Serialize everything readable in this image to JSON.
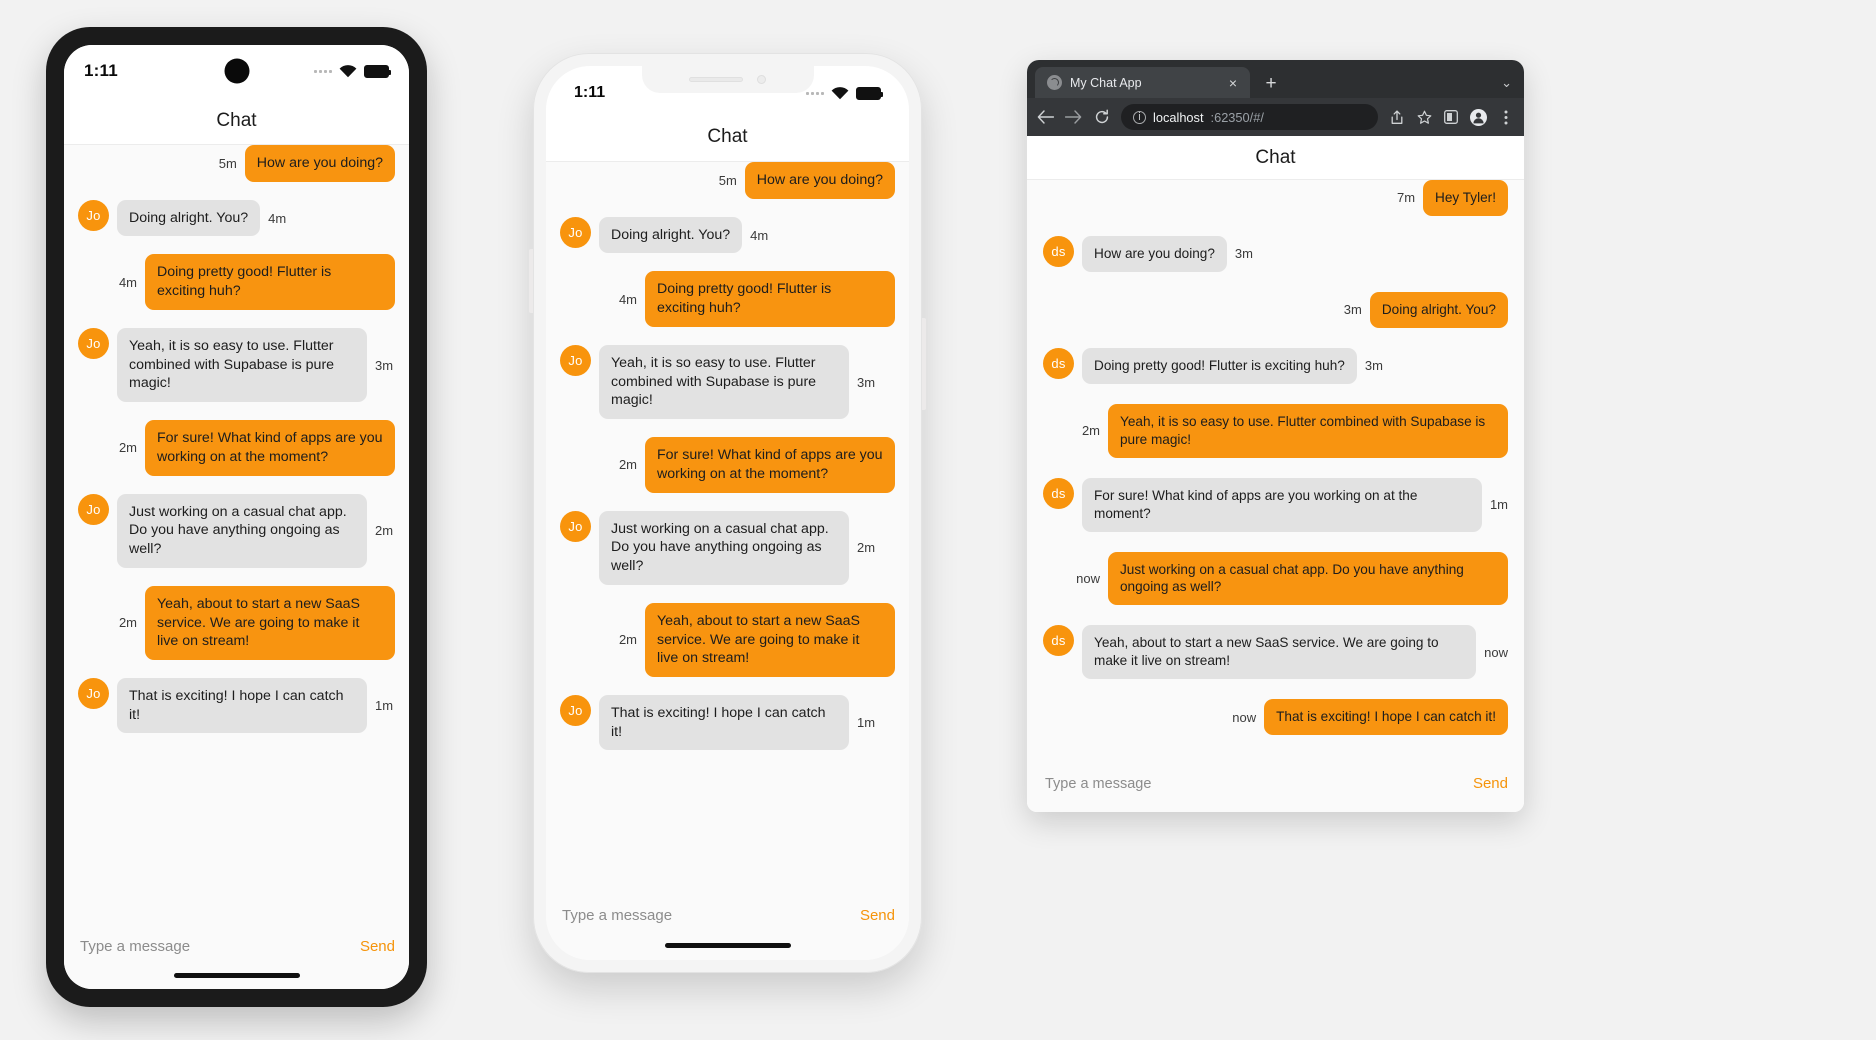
{
  "devices": {
    "android": {
      "statusbar": {
        "time": "1:11",
        "signal_icon": "signal-dots-icon",
        "wifi_icon": "wifi-icon",
        "battery_icon": "battery-icon"
      },
      "appbar": {
        "title": "Chat"
      },
      "compose": {
        "placeholder": "Type a message",
        "value": "",
        "send_label": "Send"
      },
      "messages": [
        {
          "side": "mine",
          "text": "How are you doing?",
          "time": "5m",
          "avatar": ""
        },
        {
          "side": "other",
          "text": "Doing alright. You?",
          "time": "4m",
          "avatar": "Jo"
        },
        {
          "side": "mine",
          "text": "Doing pretty good! Flutter is exciting huh?",
          "time": "4m",
          "avatar": ""
        },
        {
          "side": "other",
          "text": "Yeah, it is so easy to use. Flutter combined with Supabase is pure magic!",
          "time": "3m",
          "avatar": "Jo"
        },
        {
          "side": "mine",
          "text": "For sure! What kind of apps are you working on at the moment?",
          "time": "2m",
          "avatar": ""
        },
        {
          "side": "other",
          "text": "Just working on a casual chat app. Do you have anything ongoing as well?",
          "time": "2m",
          "avatar": "Jo"
        },
        {
          "side": "mine",
          "text": "Yeah, about to start a new SaaS service. We are going to make it live on stream!",
          "time": "2m",
          "avatar": ""
        },
        {
          "side": "other",
          "text": "That is exciting! I hope I can catch it!",
          "time": "1m",
          "avatar": "Jo"
        }
      ]
    },
    "iphone": {
      "statusbar": {
        "time": "1:11",
        "signal_icon": "signal-dots-icon",
        "wifi_icon": "wifi-icon",
        "battery_icon": "battery-icon"
      },
      "appbar": {
        "title": "Chat"
      },
      "compose": {
        "placeholder": "Type a message",
        "value": "",
        "send_label": "Send"
      },
      "messages": [
        {
          "side": "mine",
          "text": "How are you doing?",
          "time": "5m",
          "avatar": ""
        },
        {
          "side": "other",
          "text": "Doing alright. You?",
          "time": "4m",
          "avatar": "Jo"
        },
        {
          "side": "mine",
          "text": "Doing pretty good! Flutter is exciting huh?",
          "time": "4m",
          "avatar": ""
        },
        {
          "side": "other",
          "text": "Yeah, it is so easy to use. Flutter combined with Supabase is pure magic!",
          "time": "3m",
          "avatar": "Jo"
        },
        {
          "side": "mine",
          "text": "For sure! What kind of apps are you working on at the moment?",
          "time": "2m",
          "avatar": ""
        },
        {
          "side": "other",
          "text": "Just working on a casual chat app. Do you have anything ongoing as well?",
          "time": "2m",
          "avatar": "Jo"
        },
        {
          "side": "mine",
          "text": "Yeah, about to start a new SaaS service. We are going to make it live on stream!",
          "time": "2m",
          "avatar": ""
        },
        {
          "side": "other",
          "text": "That is exciting! I hope I can catch it!",
          "time": "1m",
          "avatar": "Jo"
        }
      ]
    },
    "browser": {
      "tab": {
        "title": "My Chat App",
        "favicon": "globe-icon",
        "close_label": "×"
      },
      "newtab_label": "+",
      "window_menu_label": "⌄",
      "toolbar": {
        "back_icon": "arrow-left-icon",
        "forward_icon": "arrow-right-icon",
        "reload_icon": "reload-icon",
        "share_icon": "share-icon",
        "bookmark_icon": "star-icon",
        "sidepanel_icon": "side-panel-icon",
        "profile_icon": "profile-avatar-icon",
        "menu_icon": "three-dot-menu-icon"
      },
      "omnibox": {
        "info_icon": "info-circle-icon",
        "host": "localhost",
        "rest": ":62350/#/"
      },
      "appbar": {
        "title": "Chat"
      },
      "compose": {
        "placeholder": "Type a message",
        "value": "",
        "send_label": "Send"
      },
      "messages": [
        {
          "side": "mine",
          "text": "Hey Tyler!",
          "time": "7m",
          "avatar": ""
        },
        {
          "side": "other",
          "text": "How are you doing?",
          "time": "3m",
          "avatar": "ds"
        },
        {
          "side": "mine",
          "text": "Doing alright. You?",
          "time": "3m",
          "avatar": ""
        },
        {
          "side": "other",
          "text": "Doing pretty good! Flutter is exciting huh?",
          "time": "3m",
          "avatar": "ds"
        },
        {
          "side": "mine",
          "text": "Yeah, it is so easy to use. Flutter combined with Supabase is pure magic!",
          "time": "2m",
          "avatar": ""
        },
        {
          "side": "other",
          "text": "For sure! What kind of apps are you working on at the moment?",
          "time": "1m",
          "avatar": "ds"
        },
        {
          "side": "mine",
          "text": "Just working on a casual chat app. Do you have anything ongoing as well?",
          "time": "now",
          "avatar": ""
        },
        {
          "side": "other",
          "text": "Yeah, about to start a new SaaS service. We are going to make it live on stream!",
          "time": "now",
          "avatar": "ds"
        },
        {
          "side": "mine",
          "text": "That is exciting! I hope I can catch it!",
          "time": "now",
          "avatar": ""
        }
      ]
    }
  },
  "colors": {
    "accent_orange": "#f89410",
    "bubble_grey": "#e2e2e2",
    "page_bg": "#f2f2f2",
    "chat_bg": "#fafafa"
  }
}
